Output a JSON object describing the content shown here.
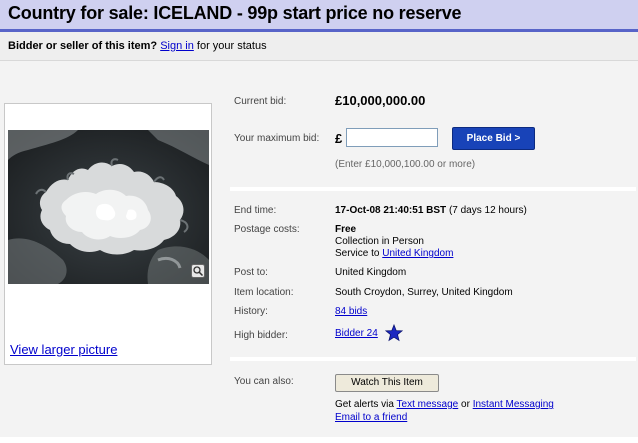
{
  "page": {
    "title": "Country for sale: ICELAND - 99p start price no reserve"
  },
  "status": {
    "prefix": "Bidder or seller of this item?",
    "sign_in": "Sign in",
    "suffix": "for your status"
  },
  "picture": {
    "view_larger": "View larger picture"
  },
  "bid": {
    "current_label": "Current bid:",
    "current_value": "£10,000,000.00",
    "max_label": "Your maximum bid:",
    "currency_symbol": "£",
    "input_value": "",
    "place_bid_label": "Place Bid >",
    "hint": "(Enter £10,000,100.00 or more)"
  },
  "details": {
    "end_time_label": "End time:",
    "end_time_value": "17-Oct-08 21:40:51 BST",
    "end_time_remaining": "(7 days 12 hours)",
    "postage_label": "Postage costs:",
    "postage_free": "Free",
    "postage_method": "Collection in Person",
    "service_prefix": "Service to",
    "service_link": "United Kingdom",
    "post_to_label": "Post to:",
    "post_to_value": "United Kingdom",
    "location_label": "Item location:",
    "location_value": "South Croydon, Surrey, United Kingdom",
    "history_label": "History:",
    "history_value": "84 bids",
    "high_bidder_label": "High bidder:",
    "high_bidder_value": "Bidder 24"
  },
  "actions": {
    "label": "You can also:",
    "watch_label": "Watch This Item",
    "alerts_prefix": "Get alerts via",
    "text_message": "Text message",
    "or": "or",
    "instant_messaging": "Instant Messaging",
    "email_friend": "Email to a friend"
  },
  "colors": {
    "title_bg": "#cfd0f0",
    "title_border": "#5864c8",
    "link": "#0000cc",
    "button_blue": "#1843b8",
    "star": "#1c28c0"
  },
  "icons": {
    "star": "star-icon",
    "image_viewer": "magnify-icon"
  }
}
